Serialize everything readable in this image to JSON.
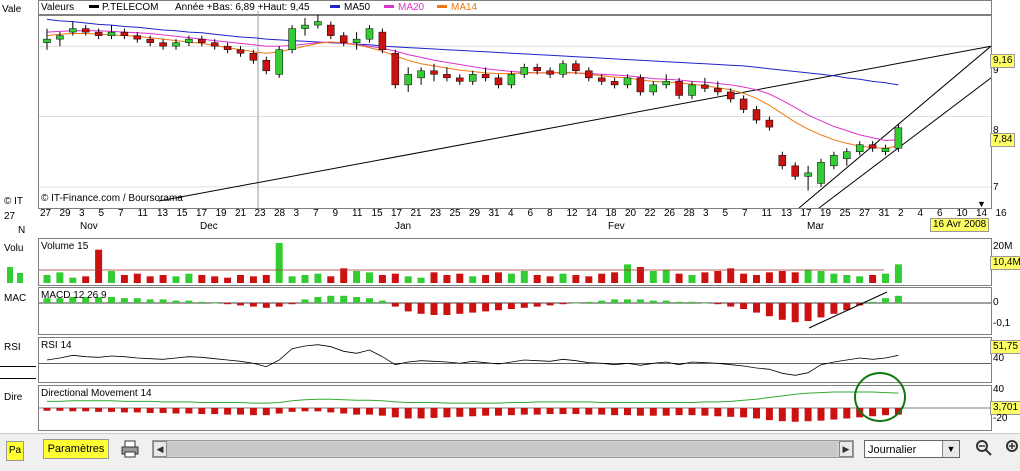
{
  "header": {
    "valeurs_label": "Valeurs",
    "symbol": "P.TELECOM",
    "range_text": "Année +Bas: 6,89 +Haut: 9,45",
    "ma50_label": "MA50",
    "ma20_label": "MA20",
    "ma14_label": "MA14",
    "copyright": "© IT-Finance.com / Boursorama"
  },
  "colors": {
    "up": "#33cc33",
    "down": "#cc1111",
    "ma50": "#2222cc",
    "ma20": "#dd33cc",
    "ma14": "#ee7711",
    "line": "#000000",
    "grid": "#cccccc",
    "dmi": "#33aa33",
    "circle": "#117711",
    "tag_bg": "#ffff66"
  },
  "left_strip": {
    "valeurs_cut": "Vale",
    "it_cut": "© IT",
    "n27": "27",
    "n_cut": "N",
    "volume_cut": "Volu",
    "macd_cut": "MAC",
    "rsi_cut": "RSI",
    "dire_cut": "Dire",
    "pa_cut": "Pa"
  },
  "price_axis": {
    "labels": [
      "9",
      "8",
      "7"
    ],
    "tag_last": "9,16",
    "tag_current": "7,84"
  },
  "date_axis": {
    "day_labels": [
      "27",
      "29",
      "3",
      "5",
      "7",
      "11",
      "13",
      "15",
      "17",
      "19",
      "21",
      "23",
      "28",
      "3",
      "7",
      "9",
      "11",
      "15",
      "17",
      "21",
      "23",
      "25",
      "29",
      "31",
      "4",
      "6",
      "8",
      "12",
      "14",
      "18",
      "20",
      "22",
      "26",
      "28",
      "3",
      "5",
      "7",
      "11",
      "13",
      "17",
      "19",
      "25",
      "27",
      "31",
      "2",
      "4",
      "6",
      "10",
      "14",
      "16"
    ],
    "month_labels": [
      {
        "text": "Nov",
        "x": "42"
      },
      {
        "text": "Dec",
        "x": "162"
      },
      {
        "text": "Jan",
        "x": "357"
      },
      {
        "text": "Fev",
        "x": "570"
      },
      {
        "text": "Mar",
        "x": "769"
      },
      {
        "text": "Av",
        "x": "918"
      }
    ],
    "date_tag": "16 Avr 2008"
  },
  "panels": {
    "volume": {
      "label": "Volume 15",
      "tag": "10,4M",
      "ticks": [
        "20M"
      ]
    },
    "macd": {
      "label": "MACD 12 26 9",
      "ticks": [
        "0",
        "-0,1"
      ]
    },
    "rsi": {
      "label": "RSI 14",
      "tag": "51,75",
      "ticks": [
        "40"
      ]
    },
    "dmi": {
      "label": "Directional Movement 14",
      "tag": "3,701",
      "ticks": [
        "40",
        "-20"
      ]
    }
  },
  "toolbar": {
    "params_label": "Paramètres",
    "period_value": "Journalier"
  },
  "chart_data": {
    "type": "candlestick",
    "title": "P.TELECOM",
    "ylim": [
      6.8,
      9.5
    ],
    "ohlc": [
      [
        9.05,
        9.25,
        8.95,
        9.1
      ],
      [
        9.1,
        9.2,
        9.0,
        9.15
      ],
      [
        9.2,
        9.35,
        9.15,
        9.25
      ],
      [
        9.25,
        9.3,
        9.15,
        9.2
      ],
      [
        9.2,
        9.25,
        9.1,
        9.15
      ],
      [
        9.15,
        9.3,
        9.1,
        9.2
      ],
      [
        9.2,
        9.25,
        9.1,
        9.15
      ],
      [
        9.15,
        9.2,
        9.05,
        9.1
      ],
      [
        9.1,
        9.15,
        9.0,
        9.05
      ],
      [
        9.05,
        9.1,
        8.95,
        9.0
      ],
      [
        9.0,
        9.1,
        8.95,
        9.05
      ],
      [
        9.05,
        9.15,
        9.0,
        9.1
      ],
      [
        9.1,
        9.15,
        9.0,
        9.05
      ],
      [
        9.05,
        9.1,
        8.95,
        9.0
      ],
      [
        9.0,
        9.05,
        8.9,
        8.95
      ],
      [
        8.95,
        9.0,
        8.85,
        8.9
      ],
      [
        8.9,
        8.95,
        8.75,
        8.8
      ],
      [
        8.8,
        8.85,
        8.6,
        8.65
      ],
      [
        8.6,
        9.0,
        8.55,
        8.95
      ],
      [
        8.95,
        9.3,
        8.9,
        9.25
      ],
      [
        9.25,
        9.4,
        9.15,
        9.3
      ],
      [
        9.3,
        9.45,
        9.25,
        9.35
      ],
      [
        9.3,
        9.35,
        9.1,
        9.15
      ],
      [
        9.15,
        9.2,
        9.0,
        9.05
      ],
      [
        9.05,
        9.2,
        8.95,
        9.1
      ],
      [
        9.1,
        9.3,
        9.05,
        9.25
      ],
      [
        9.2,
        9.25,
        8.9,
        8.95
      ],
      [
        8.9,
        8.95,
        8.4,
        8.45
      ],
      [
        8.45,
        8.7,
        8.35,
        8.6
      ],
      [
        8.55,
        8.7,
        8.45,
        8.65
      ],
      [
        8.65,
        8.75,
        8.5,
        8.6
      ],
      [
        8.6,
        8.7,
        8.5,
        8.55
      ],
      [
        8.55,
        8.6,
        8.45,
        8.5
      ],
      [
        8.5,
        8.65,
        8.45,
        8.6
      ],
      [
        8.6,
        8.7,
        8.5,
        8.55
      ],
      [
        8.55,
        8.6,
        8.4,
        8.45
      ],
      [
        8.45,
        8.65,
        8.4,
        8.6
      ],
      [
        8.6,
        8.75,
        8.55,
        8.7
      ],
      [
        8.7,
        8.75,
        8.6,
        8.65
      ],
      [
        8.65,
        8.7,
        8.55,
        8.6
      ],
      [
        8.6,
        8.8,
        8.55,
        8.75
      ],
      [
        8.75,
        8.8,
        8.6,
        8.65
      ],
      [
        8.65,
        8.7,
        8.5,
        8.55
      ],
      [
        8.55,
        8.6,
        8.45,
        8.5
      ],
      [
        8.5,
        8.55,
        8.4,
        8.45
      ],
      [
        8.45,
        8.6,
        8.4,
        8.55
      ],
      [
        8.55,
        8.6,
        8.3,
        8.35
      ],
      [
        8.35,
        8.5,
        8.3,
        8.45
      ],
      [
        8.45,
        8.6,
        8.4,
        8.5
      ],
      [
        8.5,
        8.55,
        8.25,
        8.3
      ],
      [
        8.3,
        8.5,
        8.25,
        8.45
      ],
      [
        8.45,
        8.55,
        8.35,
        8.4
      ],
      [
        8.4,
        8.5,
        8.3,
        8.35
      ],
      [
        8.35,
        8.4,
        8.2,
        8.25
      ],
      [
        8.25,
        8.3,
        8.05,
        8.1
      ],
      [
        8.1,
        8.15,
        7.9,
        7.95
      ],
      [
        7.95,
        8.0,
        7.8,
        7.85
      ],
      [
        7.45,
        7.5,
        7.25,
        7.3
      ],
      [
        7.3,
        7.35,
        7.1,
        7.15
      ],
      [
        7.15,
        7.3,
        6.95,
        7.2
      ],
      [
        7.05,
        7.4,
        7.0,
        7.35
      ],
      [
        7.3,
        7.5,
        7.25,
        7.45
      ],
      [
        7.4,
        7.55,
        7.3,
        7.5
      ],
      [
        7.5,
        7.65,
        7.45,
        7.6
      ],
      [
        7.6,
        7.65,
        7.5,
        7.55
      ],
      [
        7.5,
        7.6,
        7.45,
        7.55
      ],
      [
        7.55,
        7.9,
        7.5,
        7.84
      ]
    ],
    "ma50": [
      9.38,
      9.36,
      9.35,
      9.33,
      9.31,
      9.3,
      9.28,
      9.27,
      9.25,
      9.23,
      9.22,
      9.2,
      9.19,
      9.17,
      9.15,
      9.13,
      9.12,
      9.1,
      9.09,
      9.08,
      9.07,
      9.06,
      9.05,
      9.04,
      9.03,
      9.02,
      9.0,
      8.99,
      8.98,
      8.97,
      8.96,
      8.95,
      8.94,
      8.93,
      8.92,
      8.91,
      8.9,
      8.89,
      8.88,
      8.87,
      8.86,
      8.85,
      8.84,
      8.83,
      8.82,
      8.81,
      8.8,
      8.79,
      8.78,
      8.77,
      8.76,
      8.75,
      8.74,
      8.73,
      8.72,
      8.7,
      8.68,
      8.66,
      8.64,
      8.62,
      8.6,
      8.58,
      8.55,
      8.53,
      8.5,
      8.48,
      8.45
    ],
    "ma20": [
      9.2,
      9.21,
      9.22,
      9.22,
      9.22,
      9.21,
      9.2,
      9.19,
      9.18,
      9.16,
      9.14,
      9.12,
      9.1,
      9.08,
      9.06,
      9.04,
      9.02,
      9.0,
      9.0,
      9.01,
      9.03,
      9.05,
      9.06,
      9.04,
      9.02,
      9.0,
      8.97,
      8.93,
      8.88,
      8.84,
      8.8,
      8.77,
      8.74,
      8.71,
      8.68,
      8.66,
      8.64,
      8.63,
      8.62,
      8.62,
      8.62,
      8.62,
      8.61,
      8.6,
      8.59,
      8.58,
      8.56,
      8.54,
      8.53,
      8.52,
      8.5,
      8.49,
      8.47,
      8.45,
      8.42,
      8.38,
      8.32,
      8.23,
      8.13,
      8.02,
      7.94,
      7.86,
      7.8,
      7.74,
      7.7,
      7.66,
      7.67
    ],
    "ma14": [
      9.15,
      9.17,
      9.18,
      9.18,
      9.17,
      9.16,
      9.15,
      9.14,
      9.12,
      9.1,
      9.08,
      9.06,
      9.04,
      9.01,
      8.98,
      8.95,
      8.92,
      8.9,
      8.92,
      8.96,
      9.0,
      9.04,
      9.06,
      9.05,
      9.02,
      8.98,
      8.93,
      8.86,
      8.8,
      8.75,
      8.72,
      8.69,
      8.66,
      8.64,
      8.62,
      8.61,
      8.61,
      8.62,
      8.62,
      8.62,
      8.63,
      8.62,
      8.6,
      8.58,
      8.56,
      8.55,
      8.52,
      8.5,
      8.49,
      8.48,
      8.46,
      8.44,
      8.41,
      8.38,
      8.33,
      8.26,
      8.16,
      8.04,
      7.92,
      7.82,
      7.74,
      7.67,
      7.62,
      7.58,
      7.56,
      7.55,
      7.58
    ],
    "volume": [
      0.6,
      0.8,
      0.4,
      0.5,
      2.5,
      0.9,
      0.6,
      0.7,
      0.5,
      0.6,
      0.5,
      0.7,
      0.6,
      0.5,
      0.4,
      0.6,
      0.5,
      0.6,
      3.0,
      0.5,
      0.6,
      0.7,
      0.5,
      1.1,
      0.9,
      0.8,
      0.6,
      0.7,
      0.5,
      0.4,
      0.8,
      0.6,
      0.7,
      0.5,
      0.6,
      0.8,
      0.7,
      0.9,
      0.6,
      0.5,
      0.7,
      0.6,
      0.5,
      0.7,
      0.8,
      1.4,
      1.2,
      0.9,
      1.0,
      0.7,
      0.6,
      0.8,
      0.9,
      1.1,
      0.7,
      0.6,
      0.8,
      0.9,
      0.8,
      1.0,
      0.9,
      0.7,
      0.6,
      0.5,
      0.6,
      0.7,
      1.4
    ],
    "macd": [
      0.04,
      0.04,
      0.05,
      0.05,
      0.05,
      0.05,
      0.04,
      0.04,
      0.03,
      0.03,
      0.02,
      0.02,
      0.01,
      0.0,
      -0.01,
      -0.02,
      -0.03,
      -0.04,
      -0.03,
      -0.01,
      0.03,
      0.05,
      0.06,
      0.06,
      0.05,
      0.04,
      0.02,
      -0.03,
      -0.07,
      -0.09,
      -0.1,
      -0.1,
      -0.09,
      -0.08,
      -0.07,
      -0.06,
      -0.05,
      -0.04,
      -0.03,
      -0.02,
      -0.01,
      0.0,
      0.01,
      0.02,
      0.03,
      0.03,
      0.03,
      0.02,
      0.02,
      0.01,
      0.01,
      0.0,
      -0.01,
      -0.03,
      -0.05,
      -0.08,
      -0.11,
      -0.14,
      -0.16,
      -0.15,
      -0.12,
      -0.09,
      -0.06,
      -0.02,
      0.01,
      0.04,
      0.06
    ],
    "rsi": [
      45,
      48,
      52,
      50,
      49,
      51,
      50,
      48,
      47,
      46,
      48,
      50,
      49,
      47,
      45,
      43,
      40,
      35,
      45,
      62,
      66,
      68,
      65,
      58,
      55,
      60,
      50,
      38,
      42,
      44,
      43,
      42,
      40,
      43,
      41,
      39,
      42,
      45,
      44,
      43,
      46,
      44,
      41,
      40,
      38,
      40,
      37,
      40,
      42,
      38,
      42,
      41,
      40,
      38,
      36,
      33,
      31,
      25,
      22,
      26,
      38,
      42,
      45,
      48,
      46,
      48,
      52
    ],
    "dmi_pos": [
      12,
      12,
      13,
      13,
      13,
      13,
      12,
      12,
      12,
      11,
      11,
      11,
      10,
      10,
      10,
      10,
      9,
      9,
      10,
      13,
      15,
      16,
      16,
      15,
      14,
      14,
      13,
      11,
      10,
      10,
      10,
      9,
      9,
      9,
      9,
      9,
      10,
      10,
      11,
      11,
      11,
      11,
      11,
      10,
      10,
      10,
      10,
      10,
      10,
      10,
      10,
      11,
      11,
      12,
      14,
      16,
      19,
      22,
      25,
      27,
      28,
      29,
      29,
      29,
      29,
      28,
      27
    ],
    "dmi_neg": [
      -5,
      -5,
      -6,
      -6,
      -7,
      -7,
      -8,
      -8,
      -9,
      -9,
      -10,
      -10,
      -11,
      -11,
      -12,
      -12,
      -13,
      -13,
      -10,
      -7,
      -6,
      -6,
      -8,
      -10,
      -12,
      -12,
      -14,
      -17,
      -19,
      -19,
      -18,
      -17,
      -16,
      -15,
      -14,
      -14,
      -13,
      -12,
      -12,
      -11,
      -11,
      -11,
      -12,
      -12,
      -13,
      -13,
      -14,
      -14,
      -14,
      -13,
      -13,
      -14,
      -15,
      -16,
      -17,
      -19,
      -22,
      -24,
      -25,
      -24,
      -23,
      -21,
      -19,
      -17,
      -15,
      -13,
      -12
    ]
  }
}
